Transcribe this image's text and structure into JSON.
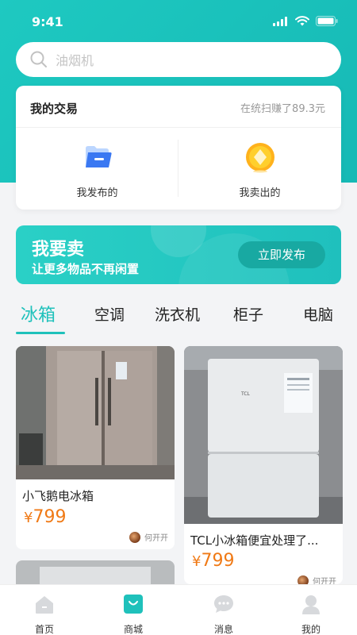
{
  "status_bar": {
    "time": "9:41"
  },
  "search": {
    "placeholder": "油烟机"
  },
  "trade_card": {
    "title": "我的交易",
    "earned_text": "在统扫赚了89.3元",
    "actions": [
      {
        "label": "我发布的",
        "icon": "folder-icon"
      },
      {
        "label": "我卖出的",
        "icon": "coin-icon"
      }
    ]
  },
  "banner": {
    "title": "我要卖",
    "subtitle": "让更多物品不再闲置",
    "button_label": "立即发布"
  },
  "categories": {
    "items": [
      "冰箱",
      "空调",
      "洗衣机",
      "柜子",
      "电脑"
    ],
    "active": "冰箱"
  },
  "products": [
    {
      "title": "小飞鹅电冰箱",
      "currency": "¥",
      "price": "799",
      "seller": "何开开"
    },
    {
      "title": "TCL小冰箱便宜处理了...",
      "currency": "¥",
      "price": "799",
      "seller": "何开开"
    },
    {
      "title": "",
      "currency": "",
      "price": "",
      "seller": ""
    }
  ],
  "tabbar": {
    "items": [
      {
        "label": "首页",
        "icon": "home-icon"
      },
      {
        "label": "商城",
        "icon": "shopping-bag-icon",
        "active": true
      },
      {
        "label": "消息",
        "icon": "chat-icon"
      },
      {
        "label": "我的",
        "icon": "user-icon"
      }
    ]
  },
  "colors": {
    "accent": "#1fc1bb",
    "price": "#f07a16",
    "banner_button": "#18a9a2"
  }
}
